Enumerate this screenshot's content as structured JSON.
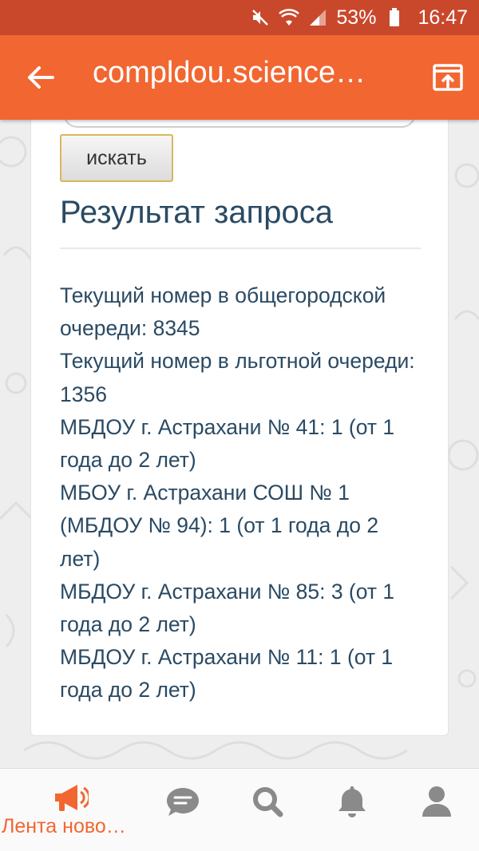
{
  "status_bar": {
    "battery": "53%",
    "time": "16:47"
  },
  "app_bar": {
    "url": "compldou.science…"
  },
  "form": {
    "search_button": "искать"
  },
  "result": {
    "title": "Результат запроса",
    "lines": [
      "Текущий номер в общегородской очереди: 8345",
      "Текущий номер в льготной очереди: 1356",
      "МБДОУ г. Астрахани № 41: 1 (от 1 года до 2 лет)",
      "МБОУ г. Астрахани СОШ № 1 (МБДОУ № 94): 1 (от 1 года до 2 лет)",
      "МБДОУ г. Астрахани № 85: 3 (от 1 года до 2 лет)",
      "МБДОУ г. Астрахани № 11: 1 (от 1 года до 2 лет)"
    ]
  },
  "bottom_nav": {
    "items": [
      {
        "label": "Лента ново…",
        "icon": "megaphone-icon",
        "active": true
      },
      {
        "icon": "chat-icon"
      },
      {
        "icon": "search-icon"
      },
      {
        "icon": "bell-icon"
      },
      {
        "icon": "profile-icon"
      }
    ]
  },
  "colors": {
    "accent": "#f26631",
    "status_bar": "#c9482b",
    "text": "#2a4a63",
    "nav_icon": "#888888"
  }
}
